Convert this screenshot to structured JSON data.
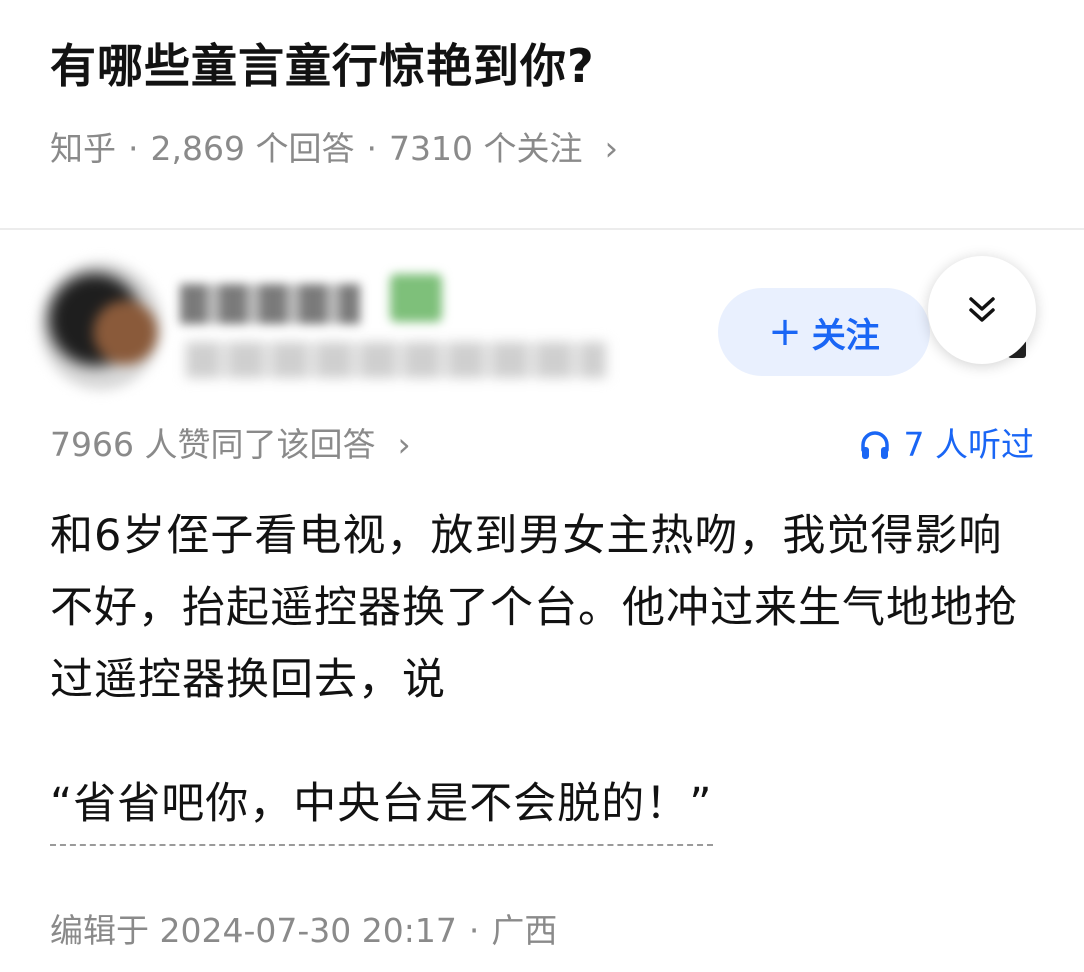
{
  "question": {
    "title": "有哪些童言童行惊艳到你?",
    "source": "知乎",
    "answers": "2,869 个回答",
    "followers": "7310 个关注",
    "separator": "·",
    "chevron": "›"
  },
  "author": {
    "follow_plus": "+",
    "follow_label": "关注"
  },
  "stats": {
    "agree_text": "7966 人赞同了该回答",
    "chevron": "›",
    "listen_text": "7 人听过"
  },
  "answer": {
    "body": "和6岁侄子看电视，放到男女主热吻，我觉得影响不好，抬起遥控器换了个台。他冲过来生气地地抢过遥控器换回去，说",
    "quote": "“省省吧你，中央台是不会脱的！”"
  },
  "footer": {
    "edited": "编辑于 2024-07-30 20:17",
    "separator": "·",
    "location": "广西"
  },
  "colors": {
    "accent": "#1a66f5",
    "follow_bg": "#e9f0fe",
    "meta": "#8a8a8a"
  },
  "icons": [
    "headphones-icon",
    "double-chevron-down-icon",
    "chevron-right-icon"
  ]
}
